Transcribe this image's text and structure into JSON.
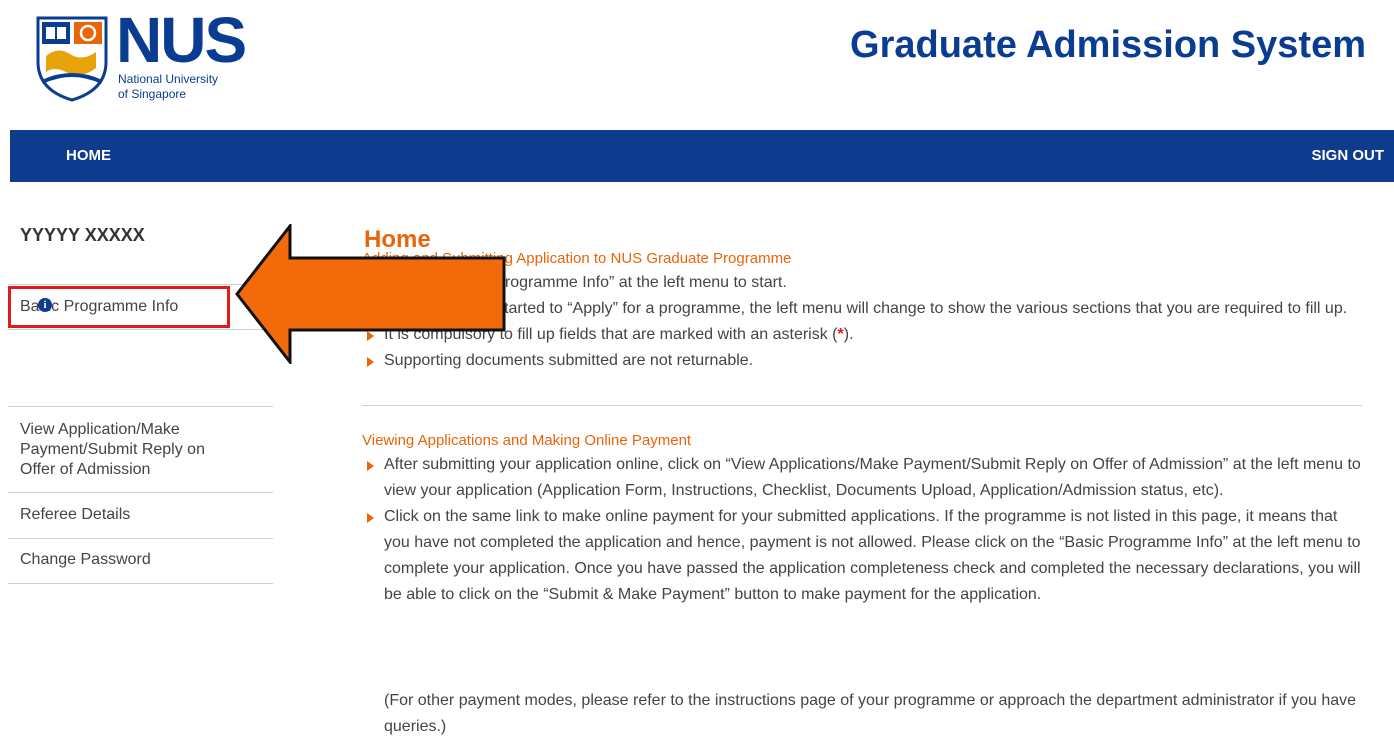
{
  "header": {
    "logo_title": "NUS",
    "logo_sub1": "National University",
    "logo_sub2": "of Singapore",
    "site_title": "Graduate Admission System"
  },
  "navbar": {
    "home": "HOME",
    "sign_out": "SIGN OUT"
  },
  "sidebar": {
    "user_name": "YYYYY XXXXX",
    "items": [
      {
        "label": "Basic Programme Info",
        "has_info_icon": true
      },
      {
        "label": "View Application/Make Payment/Submit Reply on Offer of Admission"
      },
      {
        "label": "Referee Details"
      },
      {
        "label": "Change Password"
      }
    ],
    "view_lines": [
      "View Application/Make",
      "Payment/Submit Reply on",
      "Offer of Admission"
    ]
  },
  "main": {
    "title": "Home",
    "sections": [
      {
        "heading": "Adding and Submitting Application to NUS Graduate Programme",
        "bullets": [
          "Click on “Basic Programme Info” at the left menu to start.",
          "Once you have started to “Apply” for a programme, the left menu will change to show the various sections that you are required to fill up.",
          "It is compulsory to fill up fields that are marked with an asterisk (",
          "Supporting documents submitted are not returnable."
        ],
        "asterisk": "*",
        "asterisk_suffix": ")."
      },
      {
        "heading": "Viewing Applications and Making Online Payment",
        "bullets": [
          "After submitting your application online, click on “View Applications/Make Payment/Submit Reply on Offer of Admission” at the left menu to view your application (Application Form, Instructions, Checklist, Documents Upload, Application/Admission status, etc).",
          "Click on the same link to make online payment for your submitted applications. If the programme is not listed in this page, it means that you have not completed the application and hence, payment is not allowed. Please click on the “Basic Programme Info” at the left menu to complete your application. Once you have passed the application completeness check and completed the necessary declarations, you will be able to click on the “Submit & Make Payment” button to make payment for the application."
        ],
        "note": "(For other payment modes, please refer to the instructions page of your programme or approach the department administrator if you have queries.)"
      }
    ]
  },
  "colors": {
    "brand_blue": "#0f3b8f",
    "accent_orange": "#e8650a",
    "highlight_red": "#e01b1b"
  },
  "icons": {
    "info": "info-icon",
    "arrow": "left-arrow-annotation",
    "bullet": "triangle-bullet-icon"
  }
}
